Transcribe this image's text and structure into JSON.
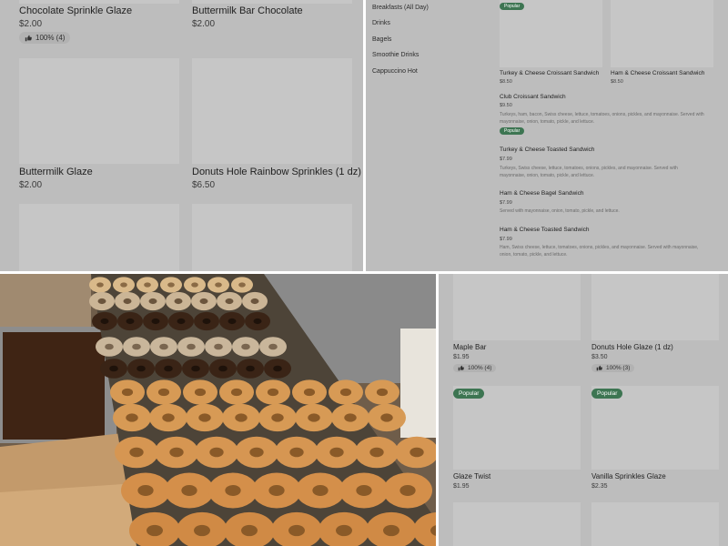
{
  "colors": {
    "panel_bg": "#bdbdbd",
    "thumb_bg": "#c6c6c6",
    "popular_badge": "#3d7552",
    "photo_bg": "#6b5a48"
  },
  "top_left": {
    "items": [
      {
        "name": "Chocolate Sprinkle Glaze",
        "price": "$2.00",
        "rating": "100% (4)",
        "rating_icon": "thumbs-up-icon"
      },
      {
        "name": "Buttermilk Bar Chocolate",
        "price": "$2.00"
      },
      {
        "name": "Buttermilk Glaze",
        "price": "$2.00"
      },
      {
        "name": "Donuts Hole Rainbow Sprinkles (1 dz)",
        "price": "$6.50"
      }
    ]
  },
  "top_right": {
    "categories": [
      "Breakfasts (All Day)",
      "Drinks",
      "Bagels",
      "Smoothie Drinks",
      "Cappuccino Hot"
    ],
    "popular_label": "Popular",
    "cards": [
      {
        "name": "Turkey & Cheese Croissant Sandwich",
        "price": "$8.50"
      },
      {
        "name": "Ham & Cheese Croissant Sandwich",
        "price": "$8.50"
      }
    ],
    "list": [
      {
        "name": "Club Croissant Sandwich",
        "price": "$9.50",
        "desc": "Turkeys, ham, bacon, Swiss cheese, lettuce, tomatoes, onions, pickles, and mayonnaise. Served with mayonnaise, onion, tomato, pickle, and lettuce."
      },
      {
        "name": "Turkey & Cheese Toasted Sandwich",
        "price": "$7.99",
        "desc": "Turkeys, Swiss cheese, lettuce, tomatoes, onions, pickles, and mayonnaise. Served with mayonnaise, onion, tomato, pickle, and lettuce."
      },
      {
        "name": "Ham & Cheese Bagel Sandwich",
        "price": "$7.99",
        "desc": "Served with mayonnaise, onion, tomato, pickle, and lettuce."
      },
      {
        "name": "Ham & Cheese Toasted Sandwich",
        "price": "$7.99",
        "desc": "Ham, Swiss cheese, lettuce, tomatoes, onions, pickles, and mayonnaise. Served with mayonnaise, onion, tomato, pickle, and lettuce."
      }
    ]
  },
  "photo": {
    "subject": "donut-display-photo"
  },
  "bottom_right": {
    "popular_label": "Popular",
    "items": [
      {
        "name": "Maple Bar",
        "price": "$1.95",
        "rating": "100% (4)",
        "rating_icon": "thumbs-up-icon"
      },
      {
        "name": "Donuts Hole Glaze (1 dz)",
        "price": "$3.50",
        "rating": "100% (3)",
        "rating_icon": "thumbs-up-icon"
      },
      {
        "name": "Glaze Twist",
        "price": "$1.95"
      },
      {
        "name": "Vanilla Sprinkles Glaze",
        "price": "$2.35"
      }
    ]
  }
}
